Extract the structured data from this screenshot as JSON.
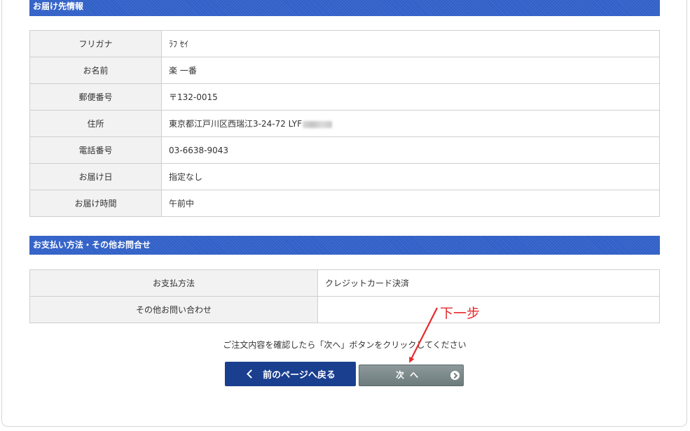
{
  "delivery": {
    "section_title": "お届け先情報",
    "rows": [
      {
        "label": "フリガナ",
        "value": "ﾗﾌ ｾｲ"
      },
      {
        "label": "お名前",
        "value": "楽 一番"
      },
      {
        "label": "郵便番号",
        "value": "〒132-0015"
      },
      {
        "label": "住所",
        "value": "東京都江戸川区西瑞江3-24-72 LYF"
      },
      {
        "label": "電話番号",
        "value": "03-6638-9043"
      },
      {
        "label": "お届け日",
        "value": "指定なし"
      },
      {
        "label": "お届け時間",
        "value": "午前中"
      }
    ]
  },
  "payment": {
    "section_title": "お支払い方法・その他お問合せ",
    "rows": [
      {
        "label": "お支払方法",
        "value": "クレジットカード決済"
      },
      {
        "label": "その他お問い合わせ",
        "value": ""
      }
    ]
  },
  "notice": "ご注文内容を確認したら「次へ」ボタンをクリックしてください",
  "buttons": {
    "back_label": "前のページへ戻る",
    "next_label": "次 へ"
  },
  "annotation": {
    "text": "下一步",
    "color": "#e8292c"
  },
  "colors": {
    "section_bar": "#2f5fc7",
    "back_button": "#1a3f8f",
    "next_button": "#7a8788"
  }
}
